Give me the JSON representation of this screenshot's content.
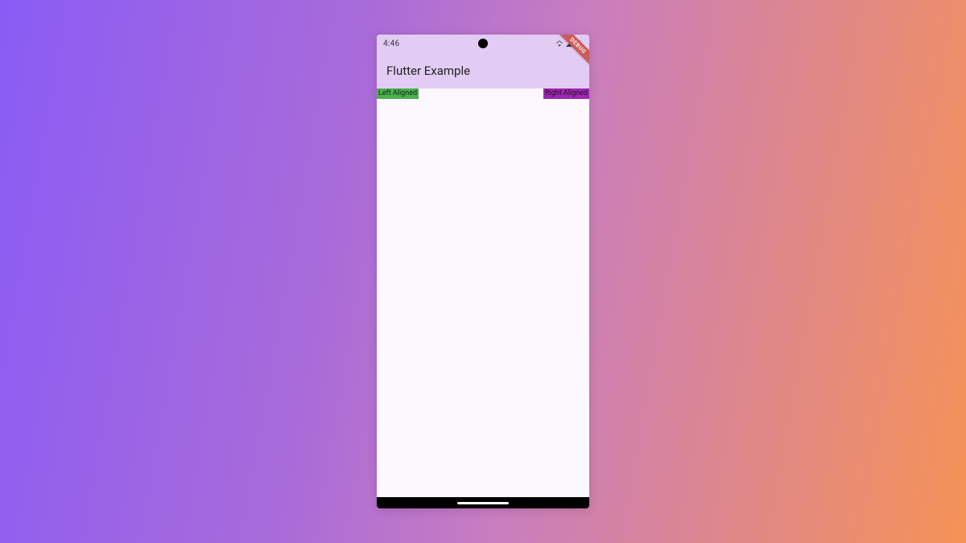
{
  "status": {
    "time": "4:46"
  },
  "debug_label": "DEBUG",
  "app_bar": {
    "title": "Flutter Example"
  },
  "content": {
    "left_label": "Left Aligned",
    "right_label": "Right Aligned"
  },
  "colors": {
    "chip_green": "#4caf50",
    "chip_purple": "#9c27b0",
    "appbar_bg": "#e2ccf4"
  }
}
